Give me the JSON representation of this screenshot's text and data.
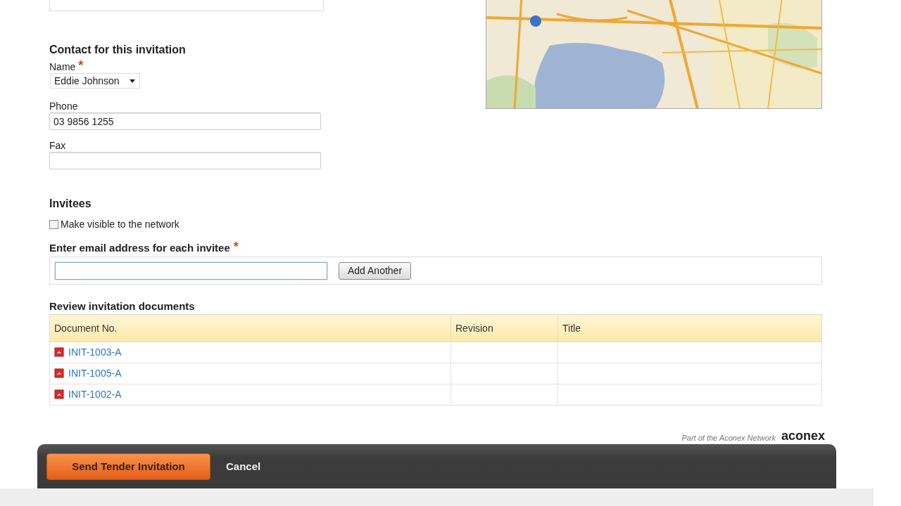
{
  "contact": {
    "heading": "Contact for this invitation",
    "name": {
      "label": "Name",
      "required_marker": "*",
      "value": "Eddie Johnson"
    },
    "phone": {
      "label": "Phone",
      "value": "03 9856 1255"
    },
    "fax": {
      "label": "Fax"
    }
  },
  "invitees": {
    "heading": "Invitees",
    "visible_checkbox": {
      "label": "Make visible to the network",
      "checked": false
    },
    "email": {
      "label": "Enter email address for each invitee",
      "required_marker": "*",
      "focused": true
    },
    "add_button": "Add Another"
  },
  "documents": {
    "heading": "Review invitation documents",
    "columns": [
      "Document No.",
      "Revision",
      "Title"
    ],
    "rows": [
      {
        "document_no": "INIT-1003-A"
      },
      {
        "document_no": "INIT-1005-A"
      },
      {
        "document_no": "INIT-1002-A"
      }
    ]
  },
  "footer": {
    "buttons": [
      {
        "label": "Send Tender Invitation",
        "kind": "primary"
      },
      {
        "label": "Cancel",
        "kind": "link"
      }
    ],
    "network_note": "Part of the Aconex Network",
    "logo": "aconex"
  }
}
